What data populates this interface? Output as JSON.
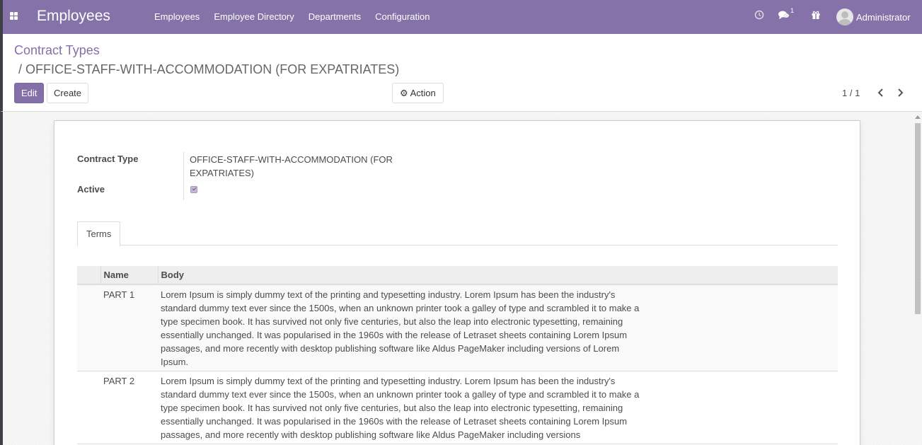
{
  "navbar": {
    "app_title": "Employees",
    "menu": [
      "Employees",
      "Employee Directory",
      "Departments",
      "Configuration"
    ],
    "messages_count": "1",
    "user_name": "Administrator",
    "bg_color": "#8572a8"
  },
  "control_panel": {
    "breadcrumb_parent": "Contract Types",
    "breadcrumb_current": "/ OFFICE-STAFF-WITH-ACCOMMODATION (FOR EXPATRIATES)",
    "edit_label": "Edit",
    "create_label": "Create",
    "action_label": "Action",
    "pager": "1 / 1"
  },
  "form": {
    "contract_type_label": "Contract Type",
    "contract_type_value": "OFFICE-STAFF-WITH-ACCOMMODATION (FOR EXPATRIATES)",
    "active_label": "Active",
    "active_checked": true,
    "tab_label": "Terms",
    "table": {
      "headers": [
        "Name",
        "Body"
      ],
      "rows": [
        {
          "name": "PART 1",
          "body": "Lorem Ipsum is simply dummy text of the printing and typesetting industry. Lorem Ipsum has been the industry's standard dummy text ever since the 1500s, when an unknown printer took a galley of type and scrambled it to make a type specimen book. It has survived not only five centuries, but also the leap into electronic typesetting, remaining essentially unchanged. It was popularised in the 1960s with the release of Letraset sheets containing Lorem Ipsum passages, and more recently with desktop publishing software like Aldus PageMaker including versions of Lorem Ipsum."
        },
        {
          "name": "PART 2",
          "body": "Lorem Ipsum is simply dummy text of the printing and typesetting industry. Lorem Ipsum has been the industry's standard dummy text ever since the 1500s, when an unknown printer took a galley of type and scrambled it to make a type specimen book. It has survived not only five centuries, but also the leap into electronic typesetting, remaining essentially unchanged. It was popularised in the 1960s with the release of Letraset sheets containing Lorem Ipsum passages, and more recently with desktop publishing software like Aldus PageMaker including versions"
        }
      ]
    }
  },
  "icons": {
    "apps": "apps-grid-icon",
    "activity": "clock-icon",
    "messages": "chat-icon",
    "gift": "gift-icon",
    "action": "gear-icon",
    "prev": "chevron-left-icon",
    "next": "chevron-right-icon"
  }
}
